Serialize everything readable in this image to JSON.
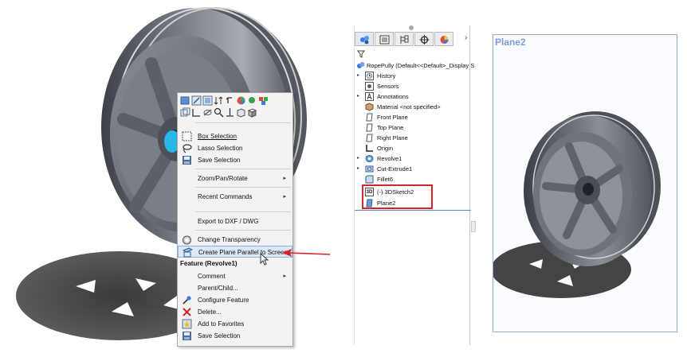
{
  "context_menu": {
    "items": [
      {
        "label": "Box Selection",
        "icon": "box-selection-icon"
      },
      {
        "label": "Lasso Selection",
        "icon": "lasso-selection-icon"
      },
      {
        "label": "Save Selection",
        "icon": "save-selection-icon"
      },
      {
        "label": "Zoom/Pan/Rotate",
        "submenu": true
      },
      {
        "label": "Recent Commands",
        "submenu": true
      },
      {
        "label": "Export to DXF / DWG"
      },
      {
        "label": "Change Transparency",
        "icon": "transparency-icon"
      },
      {
        "label": "Create Plane Parallel to Screen",
        "icon": "plane-parallel-icon"
      }
    ],
    "section_header": "Feature (Revolve1)",
    "feature_items": [
      {
        "label": "Comment",
        "submenu": true
      },
      {
        "label": "Parent/Child..."
      },
      {
        "label": "Configure Feature",
        "icon": "configure-feature-icon"
      },
      {
        "label": "Delete...",
        "icon": "delete-icon"
      },
      {
        "label": "Add to Favorites",
        "icon": "favorites-icon"
      },
      {
        "label": "Save Selection",
        "icon": "save-selection-icon"
      }
    ],
    "submenu_arrow": "▸"
  },
  "tree": {
    "more_tabs": "›",
    "root": "RopePully  (Default<<Default>_Display S",
    "items": [
      {
        "label": "History",
        "icon": "history-icon",
        "expandable": true
      },
      {
        "label": "Sensors",
        "icon": "sensors-icon",
        "expandable": false
      },
      {
        "label": "Annotations",
        "icon": "annotations-icon",
        "expandable": true
      },
      {
        "label": "Material <not specified>",
        "icon": "material-icon",
        "expandable": false
      },
      {
        "label": "Front Plane",
        "icon": "plane-icon",
        "expandable": false
      },
      {
        "label": "Top Plane",
        "icon": "plane-icon",
        "expandable": false
      },
      {
        "label": "Right Plane",
        "icon": "plane-icon",
        "expandable": false
      },
      {
        "label": "Origin",
        "icon": "origin-icon",
        "expandable": false
      },
      {
        "label": "Revolve1",
        "icon": "revolve-icon",
        "expandable": true
      },
      {
        "label": "Cut-Extrude1",
        "icon": "cut-extrude-icon",
        "expandable": true
      },
      {
        "label": "Fillet6",
        "icon": "fillet-icon",
        "expandable": false
      },
      {
        "label": "(-) 3DSketch2",
        "icon": "3d-sketch-icon",
        "expandable": false
      },
      {
        "label": "Plane2",
        "icon": "plane-icon",
        "expandable": false
      }
    ],
    "expand_glyph": "▸",
    "sketch_badge": "3D"
  },
  "plane_view": {
    "title": "Plane2"
  },
  "colors": {
    "highlight_red": "#d4262a",
    "plane_blue": "#7b9fd4",
    "menu_bg": "#f3f3f3"
  }
}
